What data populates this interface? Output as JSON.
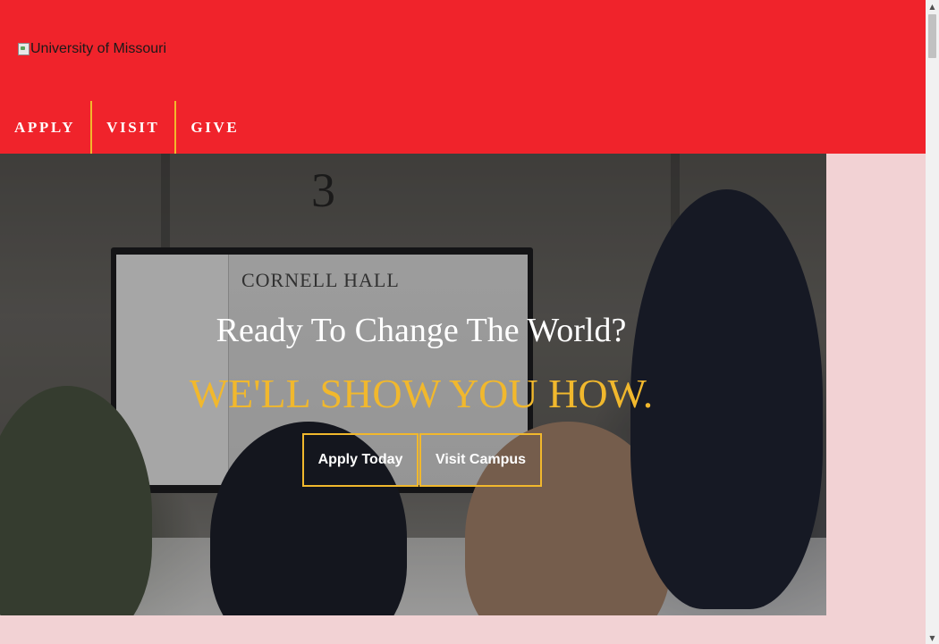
{
  "header": {
    "logo_alt": "University of Missouri",
    "background_color": "#f0232b",
    "nav": [
      {
        "label": "APPLY"
      },
      {
        "label": "VISIT"
      },
      {
        "label": "GIVE"
      }
    ],
    "divider_color": "#f1b82d"
  },
  "hero": {
    "title": "Ready To Change The World?",
    "subtitle": "WE'LL SHOW YOU HOW.",
    "accent_color": "#f1b82d",
    "background_photo_text": {
      "room_number": "3",
      "screen_heading": "CORNELL HALL"
    },
    "buttons": {
      "apply": "Apply Today",
      "visit": "Visit Campus"
    }
  },
  "page": {
    "background_color": "#f2d2d4"
  },
  "scrollbar": {
    "up_icon": "▲",
    "down_icon": "▼"
  }
}
